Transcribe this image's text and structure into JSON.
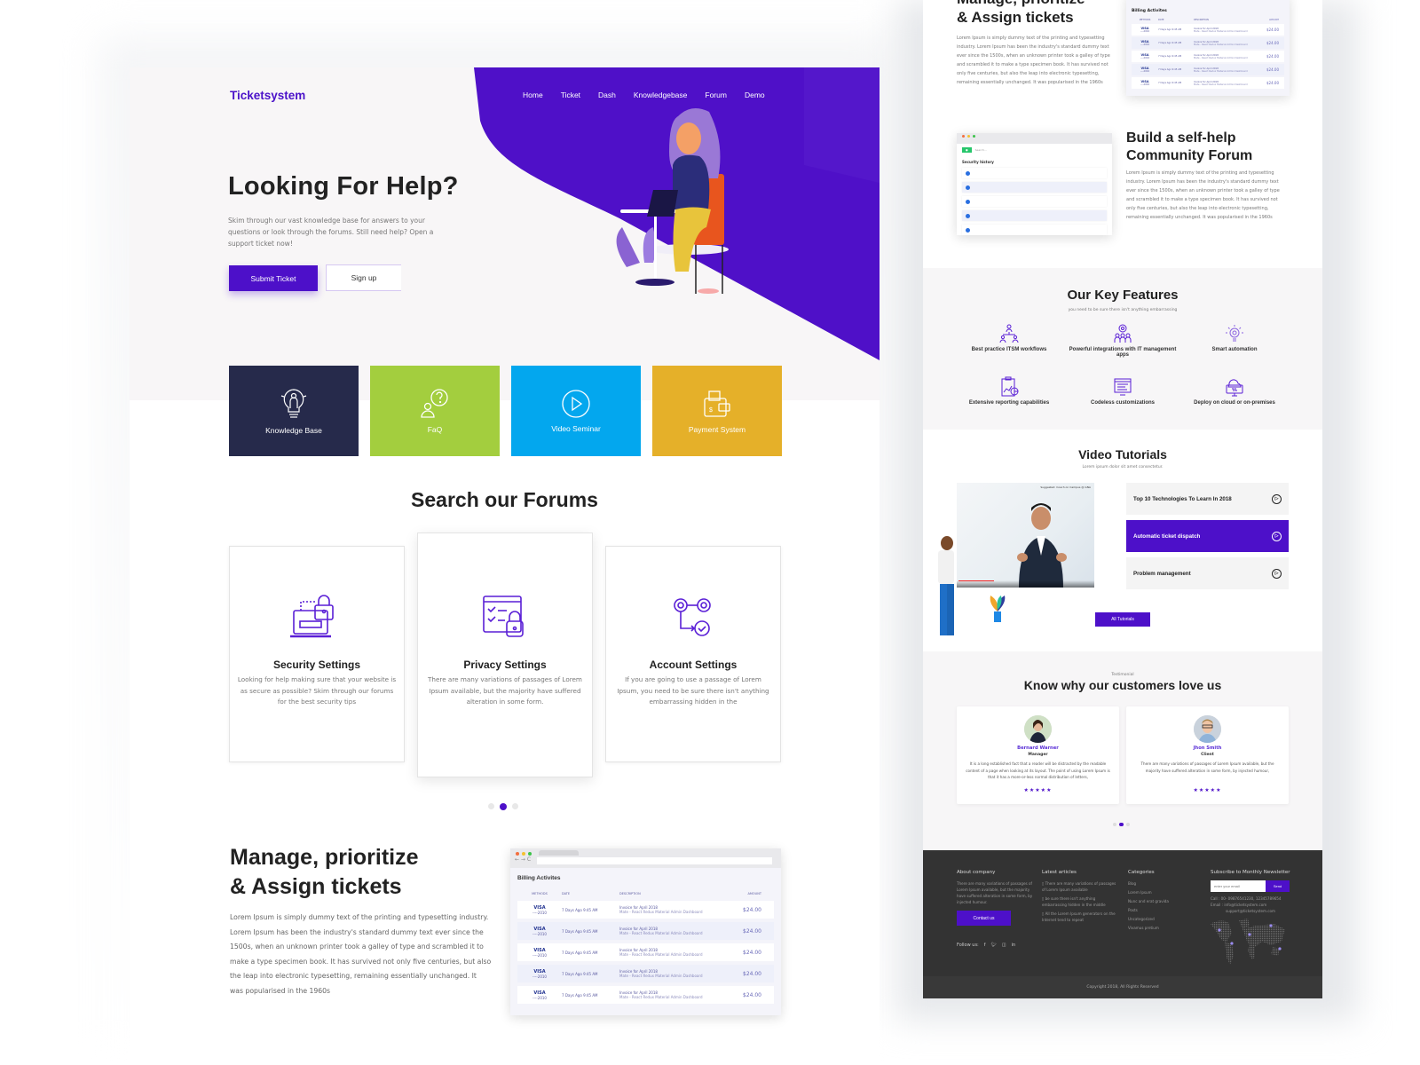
{
  "brand": {
    "name": "Ticketsystem",
    "accent": "#4d10c9"
  },
  "nav": {
    "items": [
      "Home",
      "Ticket",
      "Dash",
      "Knowledgebase",
      "Forum",
      "Demo"
    ]
  },
  "hero": {
    "title": "Looking For Help?",
    "description": "Skim through our vast knowledge base for answers to your questions or look through the forums. Still need help? Open a support ticket now!",
    "submit_label": "Submit Ticket",
    "signup_label": "Sign up"
  },
  "tiles": [
    {
      "label": "Knowledge Base",
      "icon": "lightbulb-person-icon",
      "color": "#262a4b"
    },
    {
      "label": "FaQ",
      "icon": "question-bubble-icon",
      "color": "#a3ce3e"
    },
    {
      "label": "Video Seminar",
      "icon": "play-circle-icon",
      "color": "#03a7ee"
    },
    {
      "label": "Payment System",
      "icon": "wallet-icon",
      "color": "#e5b029"
    }
  ],
  "forums": {
    "title": "Search our Forums",
    "cards": [
      {
        "title": "Security Settings",
        "text": "Looking for help making sure that your website is as secure as possible? Skim through our forums for the best security tips",
        "icon": "laptop-lock-icon"
      },
      {
        "title": "Privacy Settings",
        "text": "There are many variations of passages of Lorem Ipsum available, but the majority have suffered alteration in some form.",
        "icon": "checklist-lock-icon"
      },
      {
        "title": "Account Settings",
        "text": "If you are going to use a passage of Lorem Ipsum, you need to be sure there isn't anything embarrassing hidden in the",
        "icon": "gears-icon"
      }
    ],
    "active_slide": 2,
    "slide_count": 3
  },
  "manage": {
    "title_line1": "Manage, prioritize",
    "title_line2": "& Assign tickets",
    "description": "Lorem Ipsum is simply dummy text of the printing and typesetting industry. Lorem Ipsum has been the industry's standard dummy text ever since the 1500s, when an unknown printer took a galley of type and scrambled it to make a type specimen book. It has survived not only five centuries, but also the leap into electronic typesetting, remaining essentially unchanged. It was popularised in the 1960s"
  },
  "billing": {
    "title": "Billing Activites",
    "columns": [
      "METHODS",
      "DATE",
      "DESCRIPTION",
      "AMOUNT"
    ],
    "rows": [
      {
        "method": "VISA",
        "card": "----2010",
        "date": "7 Days Ago 9:45 AM",
        "desc": "Invoice for April 2018",
        "desc2": "Mate - React Redux Material Admin Dashboard",
        "amount": "$24.00"
      },
      {
        "method": "VISA",
        "card": "----2010",
        "date": "7 Days Ago 9:45 AM",
        "desc": "Invoice for April 2018",
        "desc2": "Mate - React Redux Material Admin Dashboard",
        "amount": "$24.00"
      },
      {
        "method": "VISA",
        "card": "----2010",
        "date": "7 Days Ago 9:45 AM",
        "desc": "Invoice for April 2018",
        "desc2": "Mate - React Redux Material Admin Dashboard",
        "amount": "$24.00"
      },
      {
        "method": "VISA",
        "card": "----2010",
        "date": "7 Days Ago 9:45 AM",
        "desc": "Invoice for April 2018",
        "desc2": "Mate - React Redux Material Admin Dashboard",
        "amount": "$24.00"
      },
      {
        "method": "VISA",
        "card": "----2010",
        "date": "7 Days Ago 9:45 AM",
        "desc": "Invoice for April 2018",
        "desc2": "Mate - React Redux Material Admin Dashboard",
        "amount": "$24.00"
      }
    ]
  },
  "community": {
    "title_line1": "Build a self-help",
    "title_line2": "Community Forum",
    "description": "Lorem Ipsum is simply dummy text of the printing and typesetting industry. Lorem Ipsum has been the industry's standard dummy text ever since the 1500s, when an unknown printer took a galley of type and scrambled it to make a type specimen book. It has survived not only five centuries, but also the leap into electronic typesetting, remaining essentially unchanged. It was popularised in the 1960s",
    "screenshot_title": "Security history",
    "screenshot_search": "Search..."
  },
  "features": {
    "title": "Our Key Features",
    "subtitle": "you need to be sure there isn't anything embarrassing",
    "items": [
      {
        "label": "Best practice ITSM workflows",
        "icon": "hierarchy-icon"
      },
      {
        "label": "Powerful integrations with IT management apps",
        "icon": "team-gear-icon"
      },
      {
        "label": "Smart automation",
        "icon": "bulb-gear-icon"
      },
      {
        "label": "Extensive reporting capabilities",
        "icon": "report-chart-icon"
      },
      {
        "label": "Codeless customizations",
        "icon": "monitor-code-icon"
      },
      {
        "label": "Deploy on cloud or on-premises",
        "icon": "cloud-monitor-icon"
      }
    ]
  },
  "videos": {
    "title": "Video Tutorials",
    "subtitle": "Lorem ipsum dolor sit amet consectetur.",
    "items": [
      {
        "label": "Top 10 Technologies To Learn In 2018",
        "active": false
      },
      {
        "label": "Automatic ticket dispatch",
        "active": true
      },
      {
        "label": "Problem management",
        "active": false
      }
    ],
    "all_label": "All Tutorials",
    "player_caption": "Suggested: Coach on Campus @ GNA"
  },
  "testimonials": {
    "eyebrow": "Testimonial",
    "title": "Know why our customers love us",
    "items": [
      {
        "name": "Bernard Warner",
        "role": "Manager",
        "text": "It is a long established fact that a reader will be distracted by the readable content of a page when looking at its layout. The point of using Lorem Ipsum is that it has a more-or-less normal distribution of letters,",
        "stars": "★★★★★",
        "rating": 5
      },
      {
        "name": "Jhon Smith",
        "role": "Client",
        "text": "There are many variations of passages of Lorem Ipsum available, but the majority have suffered alteration in some form, by injected humour,",
        "stars": "★★★★★",
        "rating": 5
      }
    ],
    "active_slide": 2,
    "slide_count": 3
  },
  "footer": {
    "about": {
      "title": "About company",
      "text": "There are many variations of passages of Lorem Ipsum available, but the majority have suffered alteration in some form, by injected humour.",
      "button": "Contact us"
    },
    "articles": {
      "title": "Latest articles",
      "items": [
        "There are many variations of passages of Lorem Ipsum available",
        "be sure there isn't anything embarrassing hidden in the middle",
        "All the Lorem Ipsum generators on the Internet tend to repeat"
      ]
    },
    "categories": {
      "title": "Categories",
      "items": [
        "Blog",
        "Lorem Ipsum",
        "Nunc and erat gravida",
        "Posts",
        "Uncategorized",
        "Vivamus pretium"
      ]
    },
    "newsletter": {
      "title": "Subscribe to Monthly Newsletter",
      "placeholder": "enter your email",
      "send": "Send",
      "call": "Call : 00- 09876541230, 12345789654",
      "email": "Email : info@ticketsystem.com",
      "email2": "support@ticketsystem.com"
    },
    "follow_label": "Follow us:",
    "social": [
      "f",
      "t",
      "ig",
      "in"
    ],
    "copyright": "Copyright 2018, All Rights Reserved"
  }
}
